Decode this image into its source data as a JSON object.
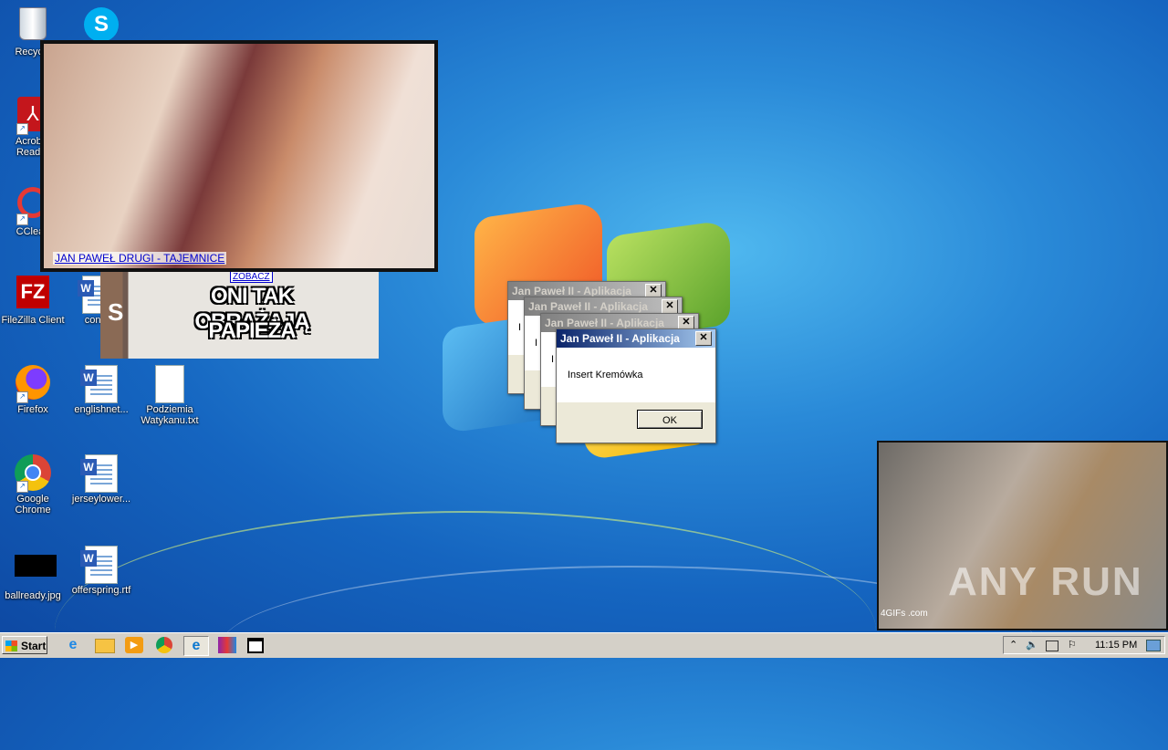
{
  "desktop": {
    "icons": [
      {
        "label": "Recycle"
      },
      {
        "label": ""
      },
      {
        "label": "Acrobat Reader"
      },
      {
        "label": "CClean"
      },
      {
        "label": "FileZilla Client"
      },
      {
        "label": "confer"
      },
      {
        "label": "Firefox"
      },
      {
        "label": "englishnet..."
      },
      {
        "label": "Podziemia Watykanu.txt"
      },
      {
        "label": "Google Chrome"
      },
      {
        "label": "jerseylower..."
      },
      {
        "label": "ballready.jpg"
      },
      {
        "label": "offerspring.rtf"
      }
    ]
  },
  "popup_top": {
    "caption_link": "JAN PAWEŁ DRUGI - TAJEMNICE",
    "zobacz": "ZOBACZ"
  },
  "popup_mid": {
    "line1": "ONI TAK OBRAŻAJĄ",
    "line2": "PAPIEŻA",
    "side_text": "S"
  },
  "popup_gif": {
    "watermark": "ANY RUN",
    "gifs_tag": "4GIFs .com"
  },
  "dialogs": {
    "title": "Jan Paweł II - Aplikacja",
    "message": "Insert Kremówka",
    "partial": "I",
    "ok": "OK",
    "close": "✕"
  },
  "taskbar": {
    "start": "Start",
    "time": "11:15 PM"
  },
  "colors": {
    "title_active": "#0a246a",
    "taskbar": "#d4d0c8",
    "wallpaper": "#1565c0"
  }
}
